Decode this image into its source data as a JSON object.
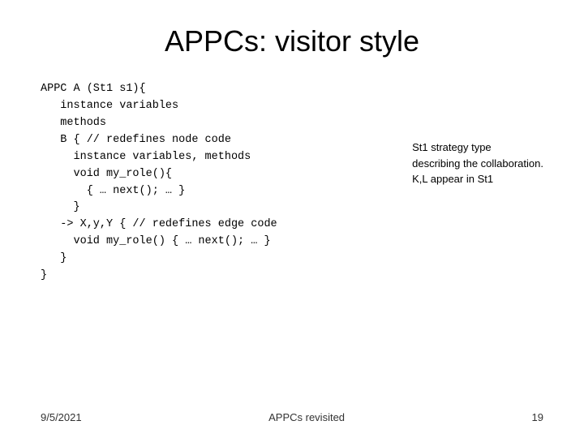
{
  "title": "APPCs: visitor style",
  "code": {
    "lines": "APPC A (St1 s1){\n   instance variables\n   methods\n   B { // redefines node code\n     instance variables, methods\n     void my_role(){\n       { … next(); … }\n     }\n   -> X,y,Y { // redefines edge code\n     void my_role() { … next(); … }\n   }\n}"
  },
  "annotation": {
    "line1": "St1 strategy type",
    "line2": "describing the collaboration.",
    "line3": "K,L appear in St1"
  },
  "footer": {
    "left": "9/5/2021",
    "center": "APPCs revisited",
    "right": "19"
  }
}
